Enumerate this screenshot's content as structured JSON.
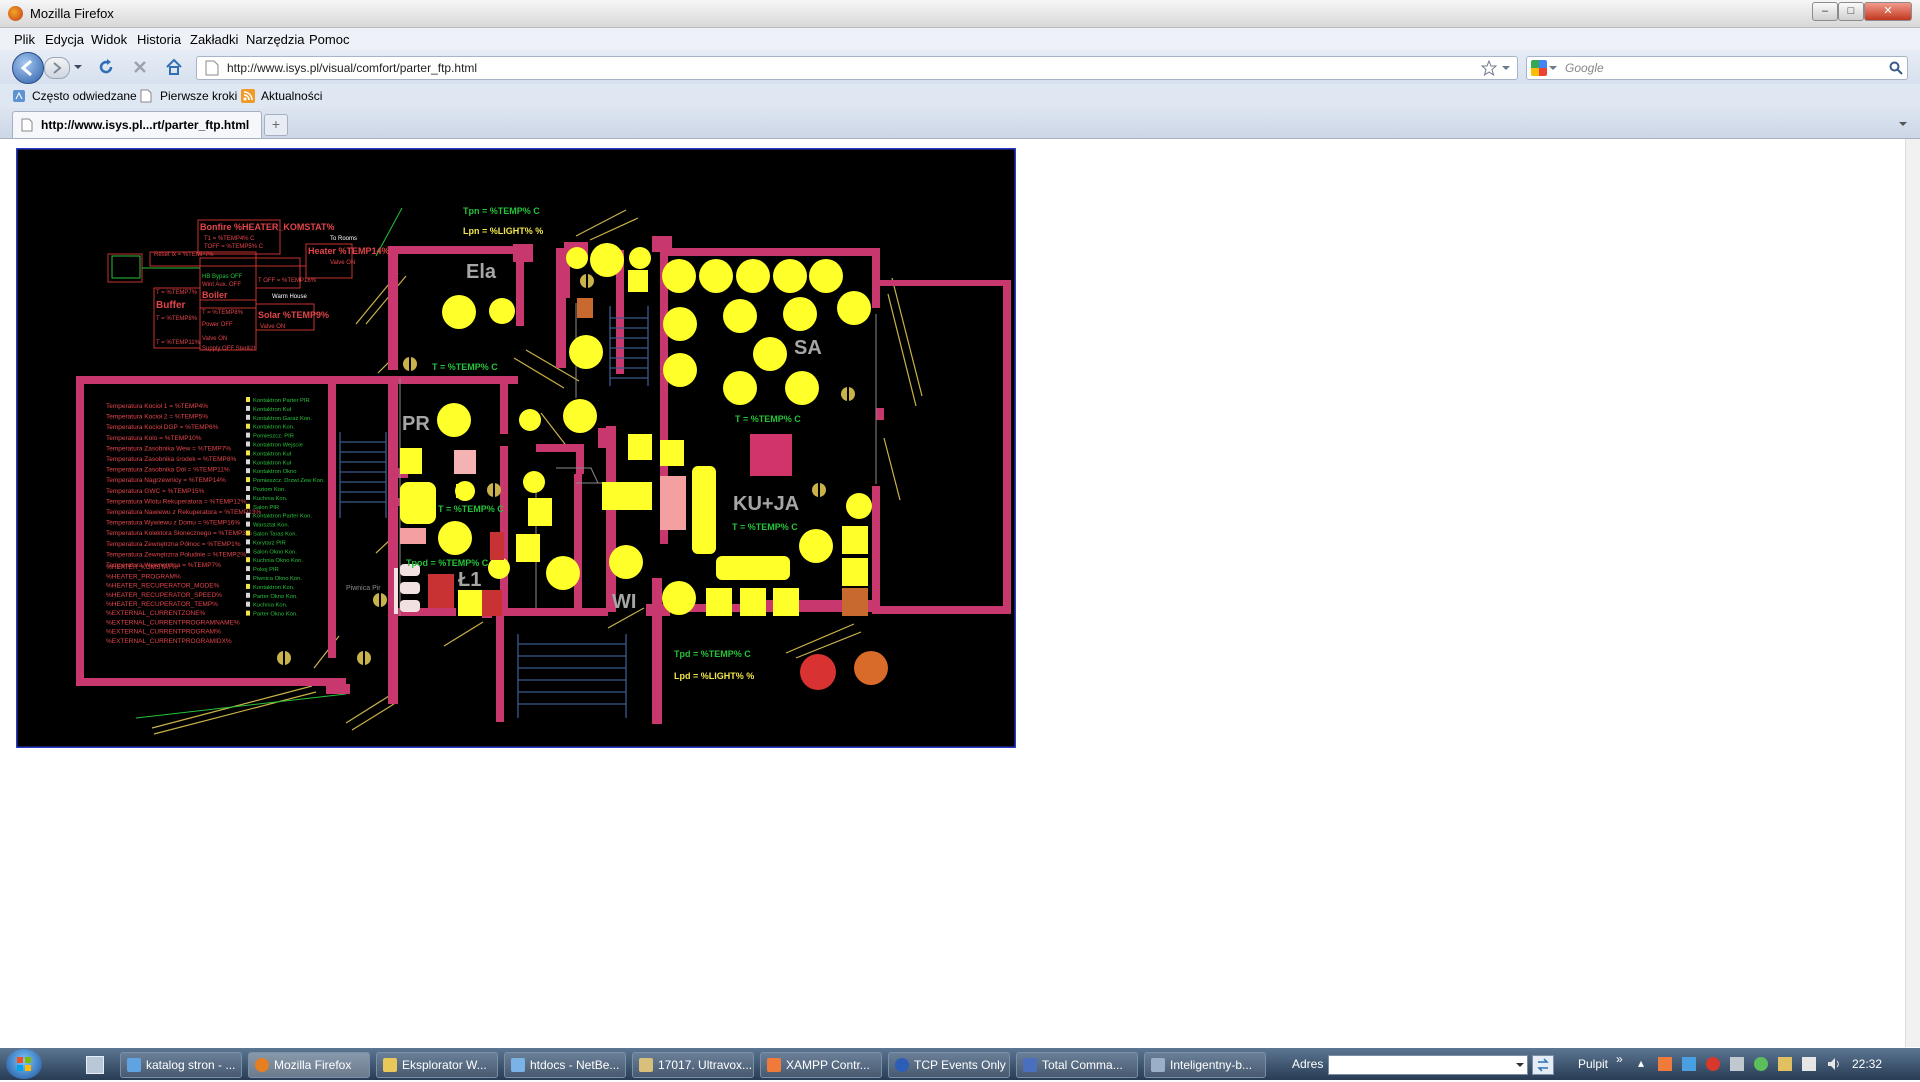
{
  "window": {
    "title": "Mozilla Firefox",
    "min": "–",
    "max": "□",
    "close": "✕"
  },
  "menu": [
    "Plik",
    "Edycja",
    "Widok",
    "Historia",
    "Zakładki",
    "Narzędzia",
    "Pomoc"
  ],
  "nav": {
    "url": "http://www.isys.pl/visual/comfort/parter_ftp.html",
    "search_placeholder": "Google"
  },
  "bookmarks": [
    "Często odwiedzane",
    "Pierwsze kroki",
    "Aktualności"
  ],
  "tabs": [
    {
      "label": "http://www.isys.pl...rt/parter_ftp.html"
    }
  ],
  "new_tab": "+",
  "floorplan": {
    "rooms": [
      "Ela",
      "SA",
      "PR",
      "KU+JA",
      "Ł1",
      "WI"
    ],
    "labels": {
      "tpn": "Tpn = %TEMP% C",
      "lpn": "Lpn = %LIGHT% %",
      "t_ela": "T = %TEMP% C",
      "t_sa": "T = %TEMP% C",
      "t_pr": "T = %TEMP% C",
      "t_ku": "T = %TEMP% C",
      "tpod": "Tpod = %TEMP% C",
      "tpd": "Tpd = %TEMP% C",
      "lpd": "Lpd = %LIGHT% %",
      "piwnica": "Piwnica Pir"
    },
    "heating": {
      "bonfire": "Bonfire %HEATER_KOMSTAT%",
      "heater": "Heater %TEMP14%",
      "buffer": "Buffer",
      "boiler": "Boiler",
      "solar": "Solar %TEMP9%",
      "to_rooms": "To Rooms",
      "warm_house": "Warm House",
      "valve_on": "Valve ON",
      "valve_on2": "Valve ON"
    },
    "left_list": [
      "Temperatura Kocioł 1 = %TEMP4%",
      "Temperatura Kocioł 2 = %TEMP5%",
      "Temperatura Kocioł DGP = %TEMP6%",
      "Temperatura Kolo = %TEMP10%",
      "Temperatura Zasobnika Wew = %TEMP7%",
      "Temperatura Zasobnika środek = %TEMP8%",
      "Temperatura Zasobnika Dół = %TEMP11%",
      "Temperatura Nagrzewnicy = %TEMP14%",
      "Temperatura GWC = %TEMP15%",
      "Temperatura Wlotu Rekuperatora = %TEMP12%",
      "Temperatura Nawiewu z Rekuperatora = %TEMP13%",
      "Temperatura Wywiewu z Domu = %TEMP16%",
      "Temperatura Kolektora Słonecznego = %TEMP3%",
      "Temperatura Zewnętrzna Północ = %TEMP1%",
      "Temperatura Zewnętrzna Południe = %TEMP2%",
      "Temperatura Wewnętrzna = %TEMP7%",
      "%HEATER_KOMSTAT%",
      "%HEATER_PROGRAM%",
      "%HEATER_RECUPERATOR_MODE%",
      "%HEATER_RECUPERATOR_SPEED%",
      "%HEATER_RECUPERATOR_TEMP%",
      "%EXTERNAL_CURRENTZONE%",
      "%EXTERNAL_CURRENTPROGRAMNAME%",
      "%EXTERNAL_CURRENTPROGRAM%",
      "%EXTERNAL_CURRENTPROGRAMIDX%"
    ],
    "right_list": [
      "Kontaktron Parter PIR",
      "Kontaktron Kuł",
      "Kontaktron Garaż Kon.",
      "Kontaktron Kon.",
      "Pomieszcz. PIR",
      "Kontaktron Wejscie",
      "Kontaktron Kuł",
      "Kontaktron Kuł",
      "Kontaktron Okno",
      "Pomieszcz. Drzwi Zew Kon.",
      "Poziom Kon.",
      "Kuchnia Kon.",
      "Salon PIR",
      "Kontaktron Parter Kon.",
      "Warsztat Kon.",
      "Salon Taras Kon.",
      "Korytarz PIR",
      "Salon Okno Kon.",
      "Kuchnia Okno Kon.",
      "Pokoj PIR",
      "Piwnica Okno Kon.",
      "Kontaktron Kon.",
      "Parter Okno Kon.",
      "Kuchnia Kon.",
      "Parter Okno Kon."
    ]
  },
  "taskbar": {
    "items": [
      "katalog stron - ...",
      "Mozilla Firefox",
      "Eksplorator W...",
      "htdocs - NetBe...",
      "17017. Ultravox...",
      "XAMPP Contr...",
      "TCP Events Only",
      "Total Comma...",
      "Inteligentny-b..."
    ],
    "address_label": "Adres",
    "desktop_label": "Pulpit",
    "clock": "22:32"
  },
  "colors": {
    "plan_bg": "#000000",
    "wall": "#c8386e",
    "lamp": "#ffff29",
    "green_text": "#26c23a",
    "red_text": "#e3454b",
    "frame": "#2a3cc8",
    "stair": "#3b5a8c"
  }
}
